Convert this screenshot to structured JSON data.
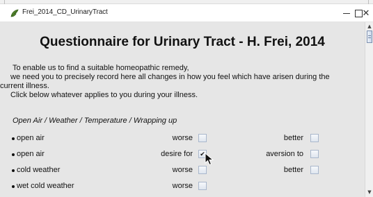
{
  "window": {
    "title": "Frei_2014_CD_UrinaryTract",
    "close_glyph": "✕"
  },
  "heading": "Questionnaire for Urinary Tract - H. Frei, 2014",
  "intro": [
    "To enable us to find a suitable homeopathic remedy,",
    "we need you to precisely record here all changes in how you feel which have arisen during the",
    "current illness.",
    "Click below whatever applies to you during your illness."
  ],
  "section_title": "Open Air / Weather / Temperature / Wrapping up",
  "rows": [
    {
      "label": "open air",
      "opt1": "worse",
      "opt1_checked": false,
      "opt2": "better",
      "opt2_checked": false
    },
    {
      "label": "open air",
      "opt1": "desire for",
      "opt1_checked": true,
      "opt2": "aversion to",
      "opt2_checked": false
    },
    {
      "label": "cold weather",
      "opt1": "worse",
      "opt1_checked": false,
      "opt2": "better",
      "opt2_checked": false
    },
    {
      "label": "wet cold weather",
      "opt1": "worse",
      "opt1_checked": false,
      "opt2": "",
      "opt2_checked": false
    }
  ],
  "check_glyph": "✔",
  "scroll_up_glyph": "▲",
  "scroll_down_glyph": "▼",
  "colors": {
    "content_bg": "#e6e6e6",
    "checkbox_border": "#a9b7cc"
  }
}
